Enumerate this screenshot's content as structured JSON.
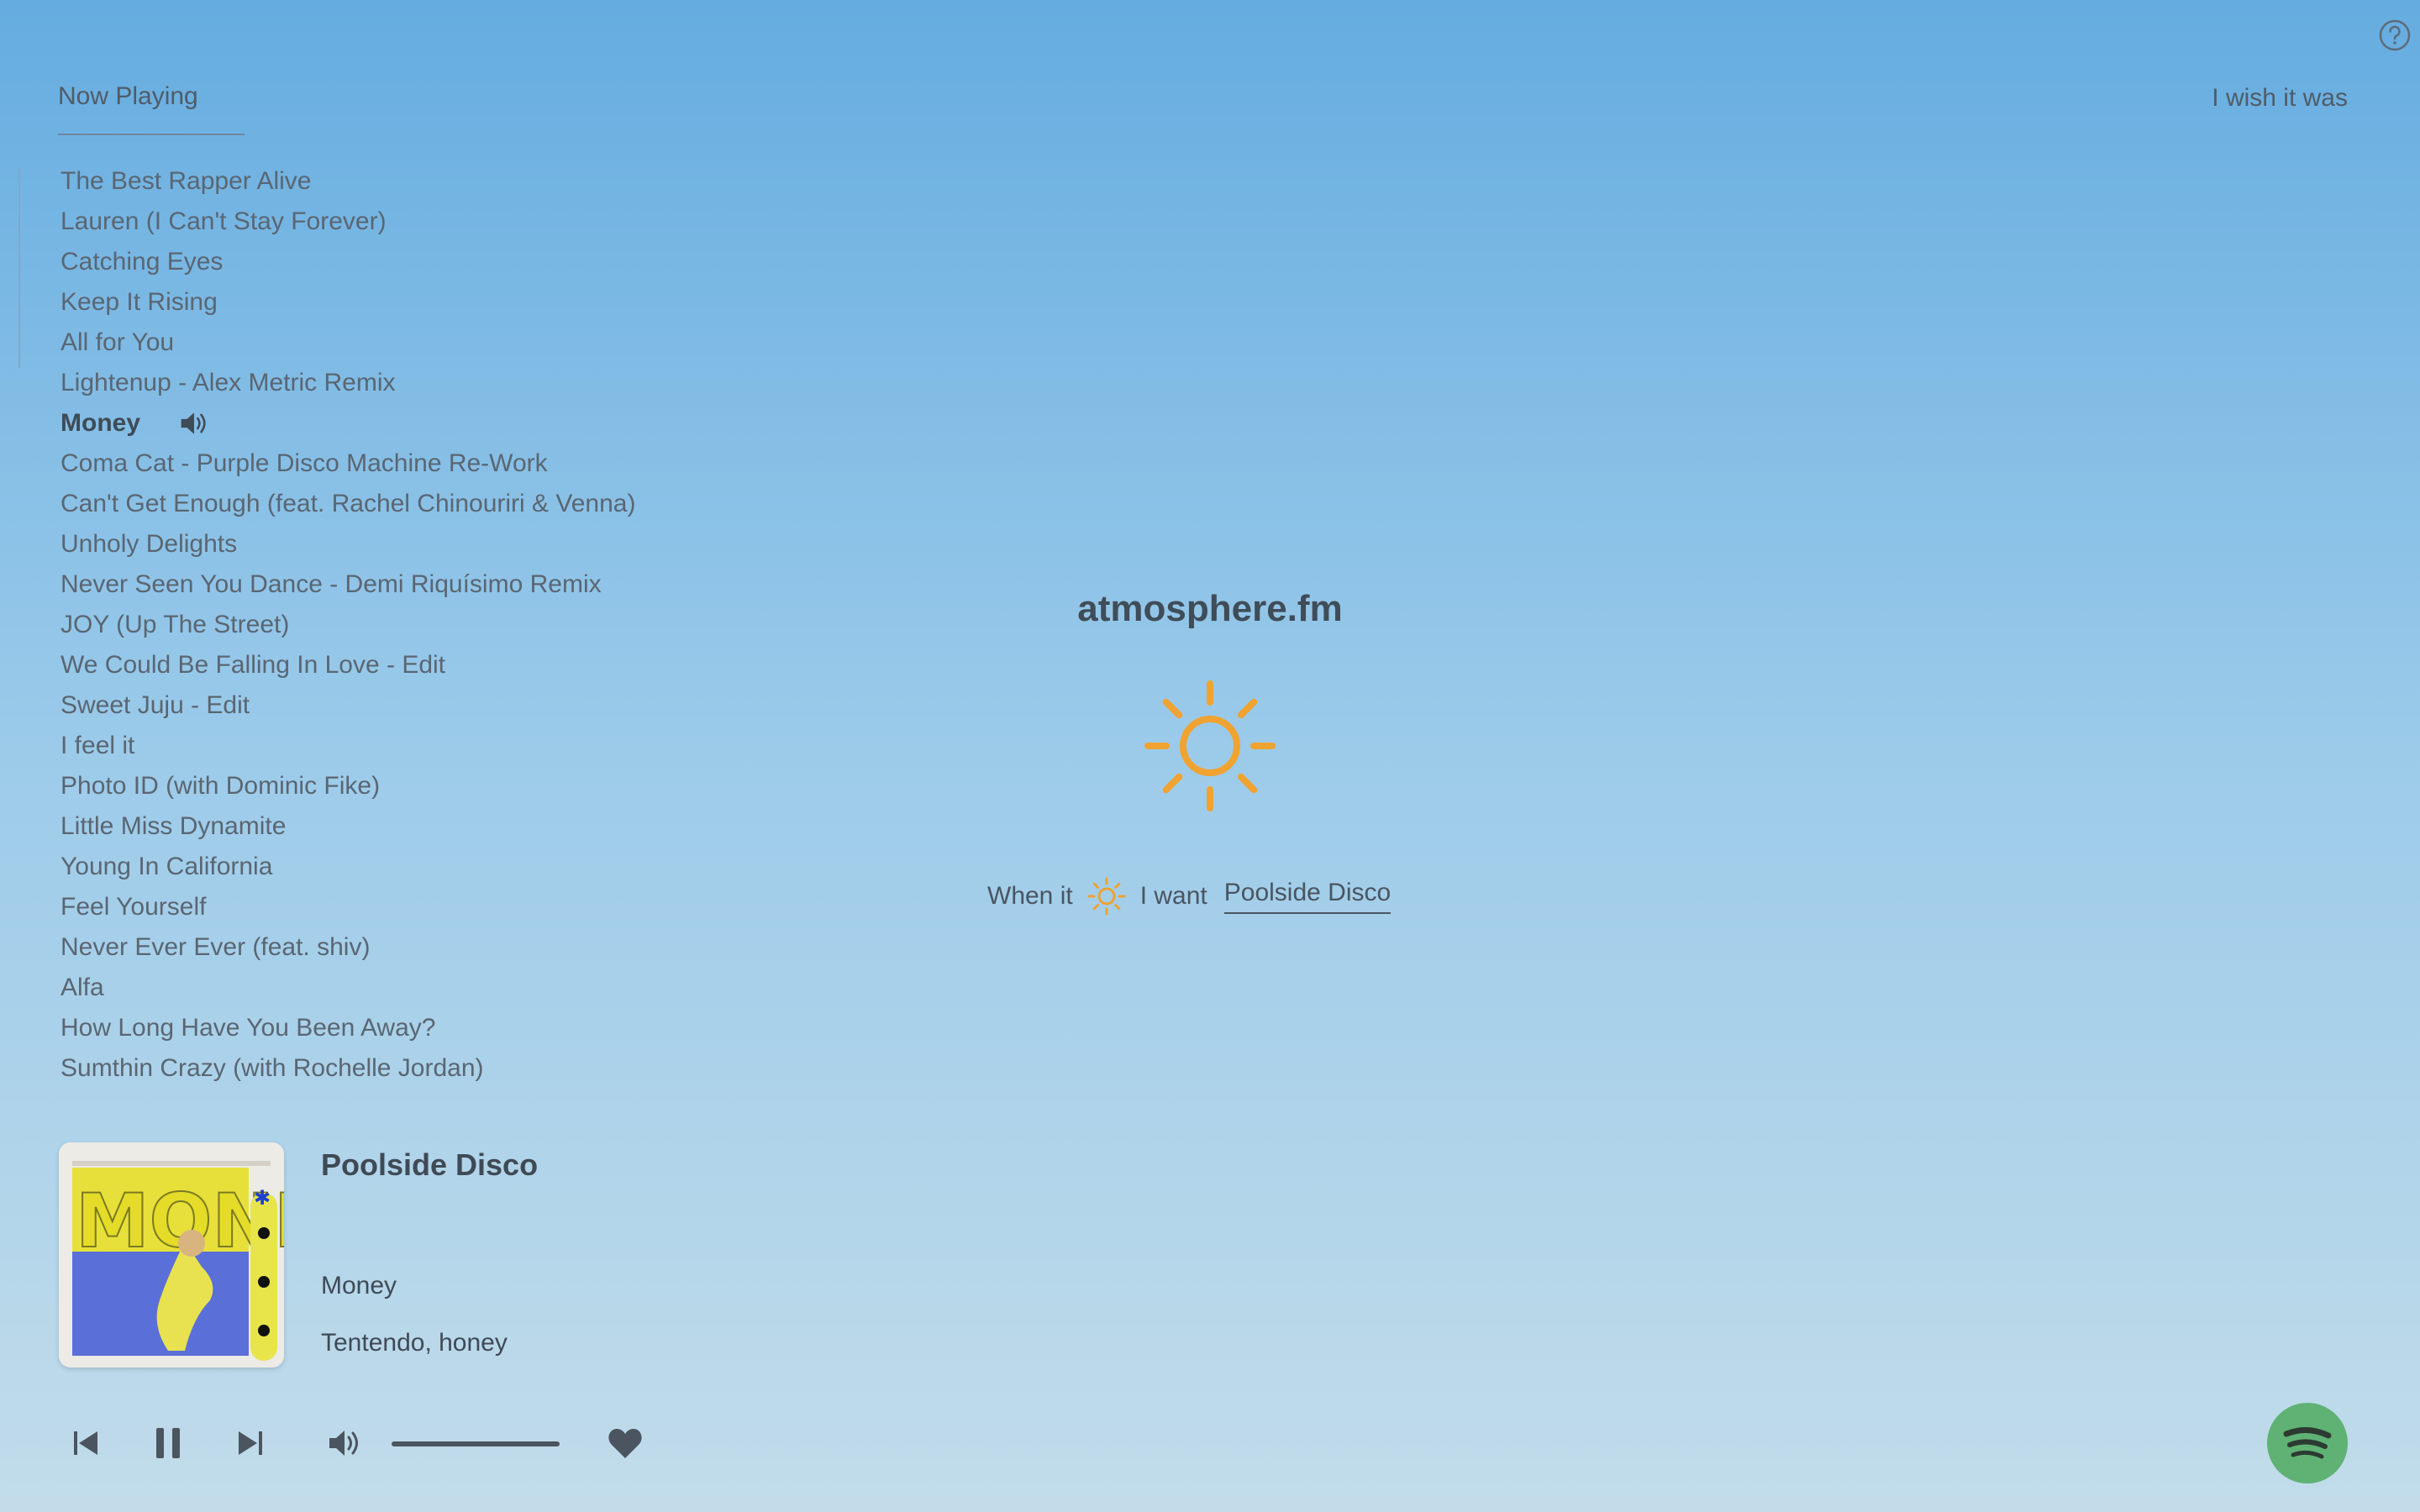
{
  "header": {
    "tab_label": "Now Playing",
    "top_right_text": "I wish it was",
    "help_icon": "help-circle-icon"
  },
  "track_list": [
    "The Best Rapper Alive",
    "Lauren (I Can't Stay Forever)",
    "Catching Eyes",
    "Keep It Rising",
    "All for You",
    "Lightenup - Alex Metric Remix",
    "Money",
    "Coma Cat - Purple Disco Machine Re-Work",
    "Can't Get Enough (feat. Rachel Chinouriri & Venna)",
    "Unholy Delights",
    "Never Seen You Dance - Demi Riquísimo Remix",
    "JOY (Up The Street)",
    "We Could Be Falling In Love - Edit",
    "Sweet Juju - Edit",
    "I feel it",
    "Photo ID (with Dominic Fike)",
    "Little Miss Dynamite",
    "Young In California",
    "Feel Yourself",
    "Never Ever Ever (feat. shiv)",
    "Alfa",
    "How Long Have You Been Away?",
    "Sumthin Crazy (with Rochelle Jordan)"
  ],
  "current_track_index": 6,
  "center": {
    "brand": "atmosphere.fm",
    "weather_icon": "sun-icon",
    "rule_prefix": "When it",
    "rule_middle": "I want",
    "rule_choice": "Poolside Disco"
  },
  "now_playing": {
    "playlist": "Poolside Disco",
    "title": "Money",
    "artist": "Tentendo, honey",
    "album_art_text": "MONEY"
  },
  "player": {
    "volume_level": 1.0,
    "icons": [
      "previous-icon",
      "pause-icon",
      "next-icon",
      "volume-icon",
      "heart-icon",
      "spotify-icon"
    ]
  },
  "colors": {
    "sun": "#f0a330",
    "spotify": "#5fb274",
    "background_top": "#65ace0",
    "background_bottom": "#c2dcea"
  }
}
